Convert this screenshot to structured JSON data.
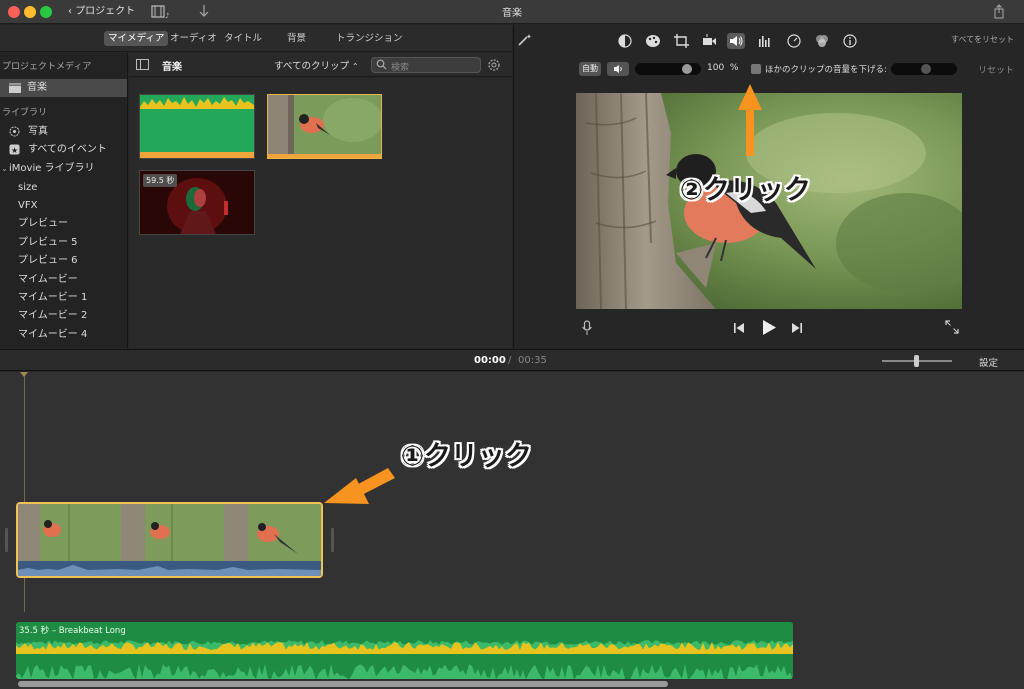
{
  "window": {
    "title": "音楽",
    "back_label": "プロジェクト"
  },
  "browser_tabs": [
    {
      "label": "マイメディア",
      "active": true
    },
    {
      "label": "オーディオ",
      "active": false
    },
    {
      "label": "タイトル",
      "active": false
    },
    {
      "label": "背景",
      "active": false
    },
    {
      "label": "トランジション",
      "active": false
    }
  ],
  "sidebar": {
    "project_media_header": "プロジェクトメディア",
    "project_item": "音楽",
    "library_header": "ライブラリ",
    "library_items": [
      "写真",
      "すべてのイベント"
    ],
    "imovie_library": "iMovie ライブラリ",
    "events": [
      "size",
      "VFX",
      "プレビュー",
      "プレビュー 5",
      "プレビュー 6",
      "マイムービー",
      "マイムービー 1",
      "マイムービー 2",
      "マイムービー 4"
    ]
  },
  "browser": {
    "title": "音楽",
    "filter": "すべてのクリップ",
    "search_placeholder": "検索",
    "clip_duration_badge": "59.5 秒"
  },
  "viewer": {
    "reset_all": "すべてをリセット",
    "auto_label": "自動",
    "volume_value": "100",
    "volume_unit": "%",
    "lower_others_label": "ほかのクリップの音量を下げる:",
    "reset_label": "リセット",
    "volume_level": 0.85
  },
  "timeline": {
    "current_time": "00:00",
    "separator": "/",
    "total_time": "00:35",
    "settings_label": "設定",
    "audio_clip_label": "35.5 秒 – Breakbeat Long"
  },
  "annotations": {
    "step1": "①クリック",
    "step2": "②クリック",
    "arrow_color": "#f7931e"
  },
  "colors": {
    "selection": "#f0c255",
    "audio_clip": "#1f8c43",
    "video_audio_bar": "#3b5a82"
  }
}
